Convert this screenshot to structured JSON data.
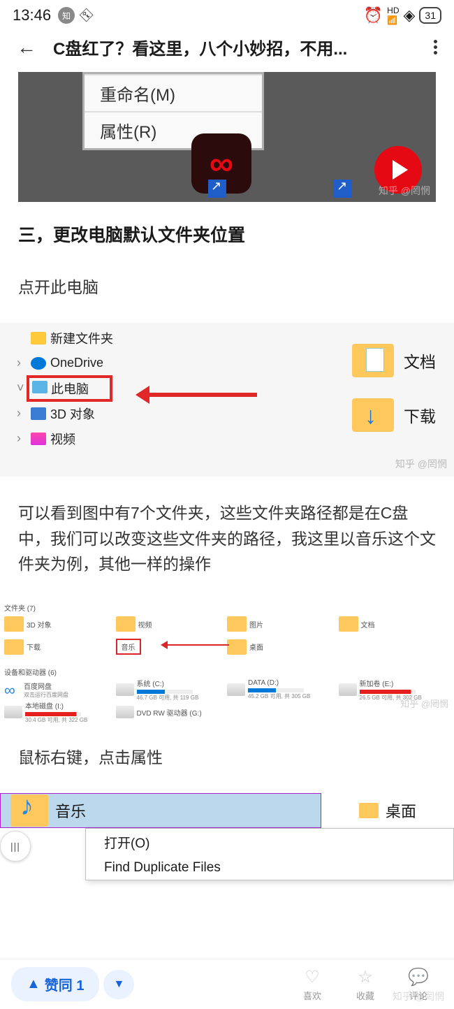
{
  "status": {
    "time": "13:46",
    "badge": "知",
    "battery": "31"
  },
  "titlebar": {
    "title": "C盘红了？看这里，八个小妙招，不用..."
  },
  "img1": {
    "menu_item1": "重命名(M)",
    "menu_item2": "属性(R)",
    "watermark": "知乎 @罔惘"
  },
  "article": {
    "heading": "三，更改电脑默认文件夹位置",
    "p1": "点开此电脑",
    "p2": "可以看到图中有7个文件夹，这些文件夹路径都是在C盘中，我们可以改变这些文件夹的路径，我这里以音乐这个文件夹为例，其他一样的操作",
    "p3": "鼠标右键，点击属性"
  },
  "img2": {
    "tree": {
      "new_folder": "新建文件夹",
      "onedrive": "OneDrive",
      "this_pc": "此电脑",
      "d3": "3D 对象",
      "video": "视频"
    },
    "folders": {
      "docs": "文档",
      "downloads": "下载"
    },
    "watermark": "知乎 @罔惘"
  },
  "img3": {
    "header": "文件夹 (7)",
    "folders": {
      "d3": "3D 对象",
      "video": "视频",
      "pictures": "图片",
      "docs": "文档",
      "downloads": "下载",
      "music": "音乐",
      "desktop": "桌面"
    },
    "header2": "设备和驱动器 (6)",
    "drives": {
      "baidu": {
        "name": "百度网盘",
        "sub": "双击运行百度网盘"
      },
      "c": {
        "name": "系统 (C:)",
        "sub": "46.7 GB 可用, 共 119 GB"
      },
      "d": {
        "name": "DATA (D:)",
        "sub": "45.2 GB 可用, 共 305 GB"
      },
      "e": {
        "name": "新加卷 (E:)",
        "sub": "26.5 GB 可用, 共 302 GB"
      },
      "local": {
        "name": "本地磁盘 (I:)",
        "sub": "30.4 GB 可用, 共 322 GB"
      },
      "dvd": {
        "name": "DVD RW 驱动器 (G:)"
      }
    },
    "watermark": "知乎 @罔惘"
  },
  "img4": {
    "music": "音乐",
    "desktop": "桌面",
    "menu": {
      "open": "打开(O)",
      "find": "Find Duplicate Files"
    }
  },
  "bottom": {
    "upvote": "赞同 1",
    "like": "喜欢",
    "favorite": "收藏",
    "comment": "评论",
    "watermark": "知乎 @罔惘"
  }
}
